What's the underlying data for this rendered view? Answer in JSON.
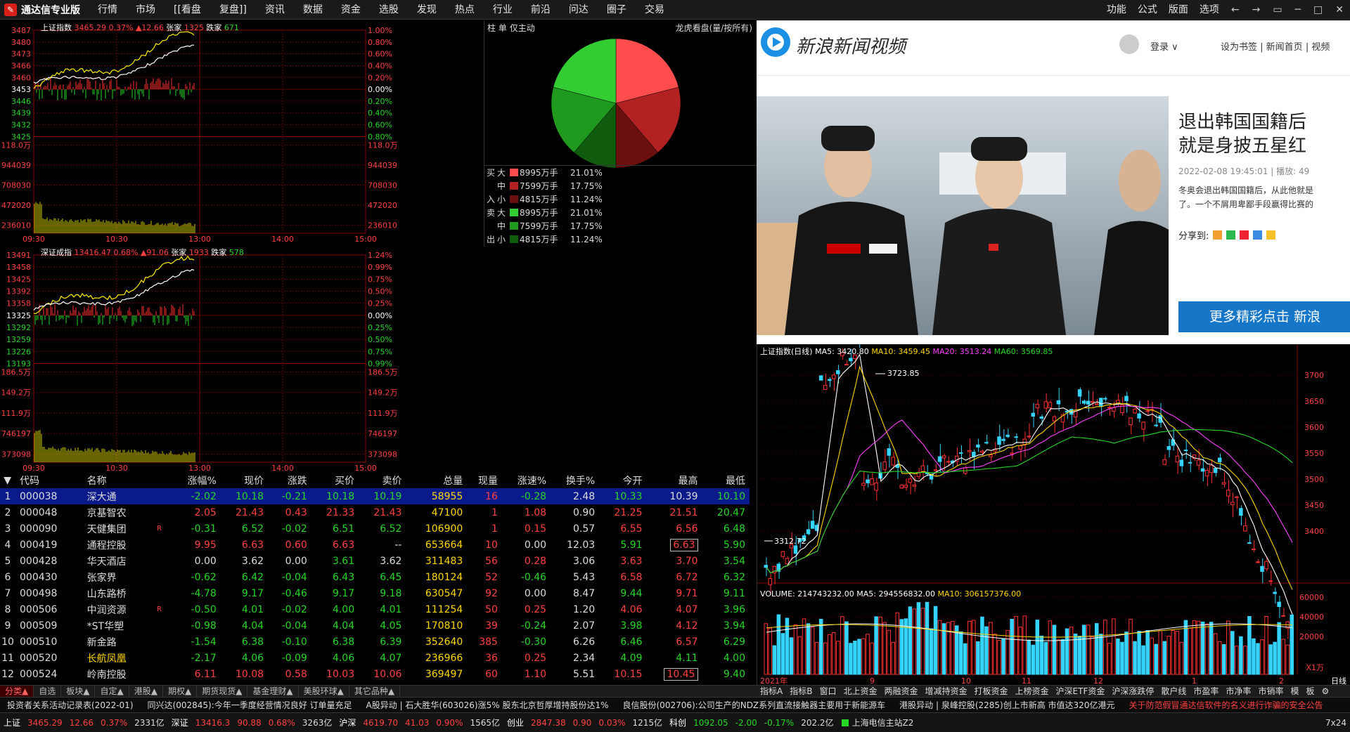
{
  "app": {
    "logo": "通达信专业版",
    "menu": [
      "行情",
      "市场",
      "[[看盘",
      "复盘]]",
      "资讯",
      "数据",
      "资金",
      "选股",
      "发现",
      "热点",
      "行业",
      "前沿",
      "问达",
      "圈子",
      "交易"
    ],
    "right_menu": [
      "功能",
      "公式",
      "版面",
      "选项"
    ],
    "win_buttons": [
      "←",
      "→",
      "▭",
      "─",
      "□",
      "✕"
    ]
  },
  "sh_chart": {
    "title": "上证指数",
    "price": "3465.29",
    "pct": "0.37%",
    "change": "▲12.66",
    "up_label": "张家",
    "up": "1325",
    "down_label": "跌家",
    "down": "671",
    "left_prices": [
      "3487",
      "3480",
      "3473",
      "3466",
      "3460",
      "3453",
      "3446",
      "3439",
      "3432",
      "3425"
    ],
    "right_pcts": [
      "1.00%",
      "0.80%",
      "0.60%",
      "0.40%",
      "0.20%",
      "0.00%",
      "0.20%",
      "0.40%",
      "0.60%",
      "0.80%"
    ],
    "vol_left": [
      "118.0万",
      "944039",
      "708030",
      "472020",
      "236010"
    ],
    "vol_right": [
      "118.0万",
      "944039",
      "708030",
      "472020",
      "236010"
    ],
    "times": [
      "09:30",
      "10:30",
      "13:00",
      "14:00",
      "15:00"
    ]
  },
  "sz_chart": {
    "title": "深证成指",
    "price": "13416.47",
    "pct": "0.68%",
    "change": "▲91.06",
    "up_label": "张家",
    "up": "1933",
    "down_label": "跌家",
    "down": "578",
    "left_prices": [
      "13491",
      "13458",
      "13425",
      "13392",
      "13358",
      "13325",
      "13292",
      "13259",
      "13226",
      "13193"
    ],
    "right_pcts": [
      "1.24%",
      "0.99%",
      "0.75%",
      "0.50%",
      "0.25%",
      "0.00%",
      "0.25%",
      "0.50%",
      "0.75%",
      "0.99%"
    ],
    "vol_left": [
      "186.5万",
      "149.2万",
      "111.9万",
      "746197",
      "373098"
    ],
    "vol_right": [
      "186.5万",
      "149.2万",
      "111.9万",
      "746197",
      "373098"
    ],
    "times": [
      "09:30",
      "10:30",
      "13:00",
      "14:00",
      "15:00"
    ]
  },
  "pie": {
    "tabs": [
      "柱",
      "单",
      "仅主动"
    ],
    "right_label": "龙虎看盘(量/按所有)",
    "buy_label": [
      "买",
      "入"
    ],
    "sell_label": [
      "卖",
      "出"
    ],
    "buy": [
      {
        "size": "大",
        "amount": "8995万手",
        "pct": "21.01%",
        "color": "#ff4d4d"
      },
      {
        "size": "中",
        "amount": "7599万手",
        "pct": "17.75%",
        "color": "#b22222"
      },
      {
        "size": "小",
        "amount": "4815万手",
        "pct": "11.24%",
        "color": "#6b0f0f"
      }
    ],
    "sell": [
      {
        "size": "大",
        "amount": "8995万手",
        "pct": "21.01%",
        "color": "#33cc33"
      },
      {
        "size": "中",
        "amount": "7599万手",
        "pct": "17.75%",
        "color": "#1f9a1f"
      },
      {
        "size": "小",
        "amount": "4815万手",
        "pct": "11.24%",
        "color": "#0f5c0f"
      }
    ]
  },
  "table": {
    "headers": [
      "代码",
      "名称",
      "",
      "涨幅%",
      "现价",
      "涨跌",
      "买价",
      "卖价",
      "总量",
      "现量",
      "涨速%",
      "换手%",
      "今开",
      "最高",
      "最低"
    ],
    "rows": [
      [
        "1",
        "000038",
        "深大通",
        "",
        "-2.02",
        "10.18",
        "-0.21",
        "10.18",
        "10.19",
        "58955",
        "16",
        "-0.28",
        "2.48",
        "10.33",
        "10.39",
        "10.10"
      ],
      [
        "2",
        "000048",
        "京基智农",
        "",
        "2.05",
        "21.43",
        "0.43",
        "21.33",
        "21.43",
        "47100",
        "1",
        "1.08",
        "0.90",
        "21.25",
        "21.51",
        "20.47"
      ],
      [
        "3",
        "000090",
        "天健集团",
        "R",
        "-0.31",
        "6.52",
        "-0.02",
        "6.51",
        "6.52",
        "106900",
        "1",
        "0.15",
        "0.57",
        "6.55",
        "6.56",
        "6.48"
      ],
      [
        "4",
        "000419",
        "通程控股",
        "",
        "9.95",
        "6.63",
        "0.60",
        "6.63",
        "--",
        "653664",
        "10",
        "0.00",
        "12.03",
        "5.91",
        "6.63",
        "5.90"
      ],
      [
        "5",
        "000428",
        "华天酒店",
        "",
        "0.00",
        "3.62",
        "0.00",
        "3.61",
        "3.62",
        "311483",
        "56",
        "0.28",
        "3.06",
        "3.63",
        "3.70",
        "3.54"
      ],
      [
        "6",
        "000430",
        "张家界",
        "",
        "-0.62",
        "6.42",
        "-0.04",
        "6.43",
        "6.45",
        "180124",
        "52",
        "-0.46",
        "5.43",
        "6.58",
        "6.72",
        "6.32"
      ],
      [
        "7",
        "000498",
        "山东路桥",
        "",
        "-4.78",
        "9.17",
        "-0.46",
        "9.17",
        "9.18",
        "630547",
        "92",
        "0.00",
        "8.47",
        "9.44",
        "9.71",
        "9.11"
      ],
      [
        "8",
        "000506",
        "中润资源",
        "R",
        "-0.50",
        "4.01",
        "-0.02",
        "4.00",
        "4.01",
        "111254",
        "50",
        "0.25",
        "1.20",
        "4.06",
        "4.07",
        "3.96"
      ],
      [
        "9",
        "000509",
        "*ST华塑",
        "",
        "-0.98",
        "4.04",
        "-0.04",
        "4.04",
        "4.05",
        "170810",
        "39",
        "-0.24",
        "2.07",
        "3.98",
        "4.12",
        "3.94"
      ],
      [
        "10",
        "000510",
        "新金路",
        "",
        "-1.54",
        "6.38",
        "-0.10",
        "6.38",
        "6.39",
        "352640",
        "385",
        "-0.30",
        "6.26",
        "6.46",
        "6.57",
        "6.29"
      ],
      [
        "11",
        "000520",
        "长航凤凰",
        "",
        "-2.17",
        "4.06",
        "-0.09",
        "4.06",
        "4.07",
        "236966",
        "36",
        "0.25",
        "2.34",
        "4.09",
        "4.11",
        "4.00"
      ],
      [
        "12",
        "000524",
        "岭南控股",
        "",
        "6.11",
        "10.08",
        "0.58",
        "10.03",
        "10.06",
        "369497",
        "60",
        "1.10",
        "5.51",
        "10.15",
        "10.45",
        "9.40"
      ]
    ]
  },
  "bottom_tabs": [
    "分类▲",
    "自选",
    "板块▲",
    "自定▲",
    "港股▲",
    "期权▲",
    "期货现货▲",
    "基金理财▲",
    "美股环球▲",
    "其它品种▲"
  ],
  "kline_tabs": [
    "指标A",
    "指标B",
    "窗口",
    "北上资金",
    "两融资金",
    "增减持资金",
    "打板资金",
    "上榜资金",
    "沪深ETF资金",
    "沪深涨跌停",
    "散户线",
    "市盈率",
    "市净率",
    "市销率",
    "模",
    "板",
    "⚙"
  ],
  "news": [
    "投资者关系活动记录表(2022-01)",
    "同兴达(002845):今年一季度经营情况良好 订单量充足",
    "A股异动 | 石大胜华(603026)涨5% 股东北京哲厚增持股份达1%",
    "良信股份(002706):公司生产的NDZ系列直流接触器主要用于新能源车",
    "港股异动 | 泉峰控股(2285)创上市新高 市值达320亿港元",
    "关于防范假冒通达信软件的名义进行诈骗的安全公告"
  ],
  "status": {
    "sh_label": "上证",
    "sh_price": "3465.29",
    "sh_chg": "12.66",
    "sh_pct": "0.37%",
    "sh_amt": "2331亿",
    "sz_label": "深证",
    "sz_price": "13416.3",
    "sz_chg": "90.88",
    "sz_pct": "0.68%",
    "sz_amt": "3263亿",
    "hs_label": "沪深",
    "hs_price": "4619.70",
    "hs_chg": "41.03",
    "hs_pct": "0.90%",
    "hs_amt": "1565亿",
    "cy_label": "创业",
    "cy_price": "2847.38",
    "cy_chg": "0.90",
    "cy_pct": "0.03%",
    "cy_amt": "1215亿",
    "kc_label": "科创",
    "kc_price": "1092.05",
    "kc_chg": "-2.00",
    "kc_pct": "-0.17%",
    "kc_amt": "202.2亿",
    "site": "上海电信主站Z2",
    "clock": "7x24"
  },
  "browser": {
    "brand": "新浪新闻视频",
    "login": "登录 ∨",
    "links": [
      "设为书签",
      "新闻首页",
      "视频"
    ],
    "headline_1": "退出韩国国籍后",
    "headline_2": "就是身披五星红",
    "date": "2022-02-08 19:45:01",
    "plays": "| 播放: 49",
    "desc_1": "冬奥会退出韩国国籍后，从此他就是",
    "desc_2": "了。一个不屑用卑鄙手段赢得比赛的",
    "share": "分享到:",
    "more": "更多精彩点击 新浪"
  },
  "kline": {
    "title": "上证指数(日线)",
    "ma5": "MA5: 3420.80",
    "ma10": "MA10: 3459.45",
    "ma20": "MA20: 3513.24",
    "ma60": "MA60: 3569.85",
    "high_label": "3723.85",
    "low_label": "3312.72",
    "price_ticks": [
      "3700",
      "3650",
      "3600",
      "3550",
      "3500",
      "3450",
      "3400"
    ],
    "vol_title": "VOLUME: 214743232.00",
    "vol_ma5": "MA5: 294556832.00",
    "vol_ma10": "MA10: 306157376.00",
    "vol_ticks": [
      "60000",
      "40000",
      "20000"
    ],
    "vol_unit": "X1万",
    "x_labels": [
      "2021年",
      "9",
      "10",
      "11",
      "12",
      "1",
      "2"
    ],
    "period": "日线"
  }
}
